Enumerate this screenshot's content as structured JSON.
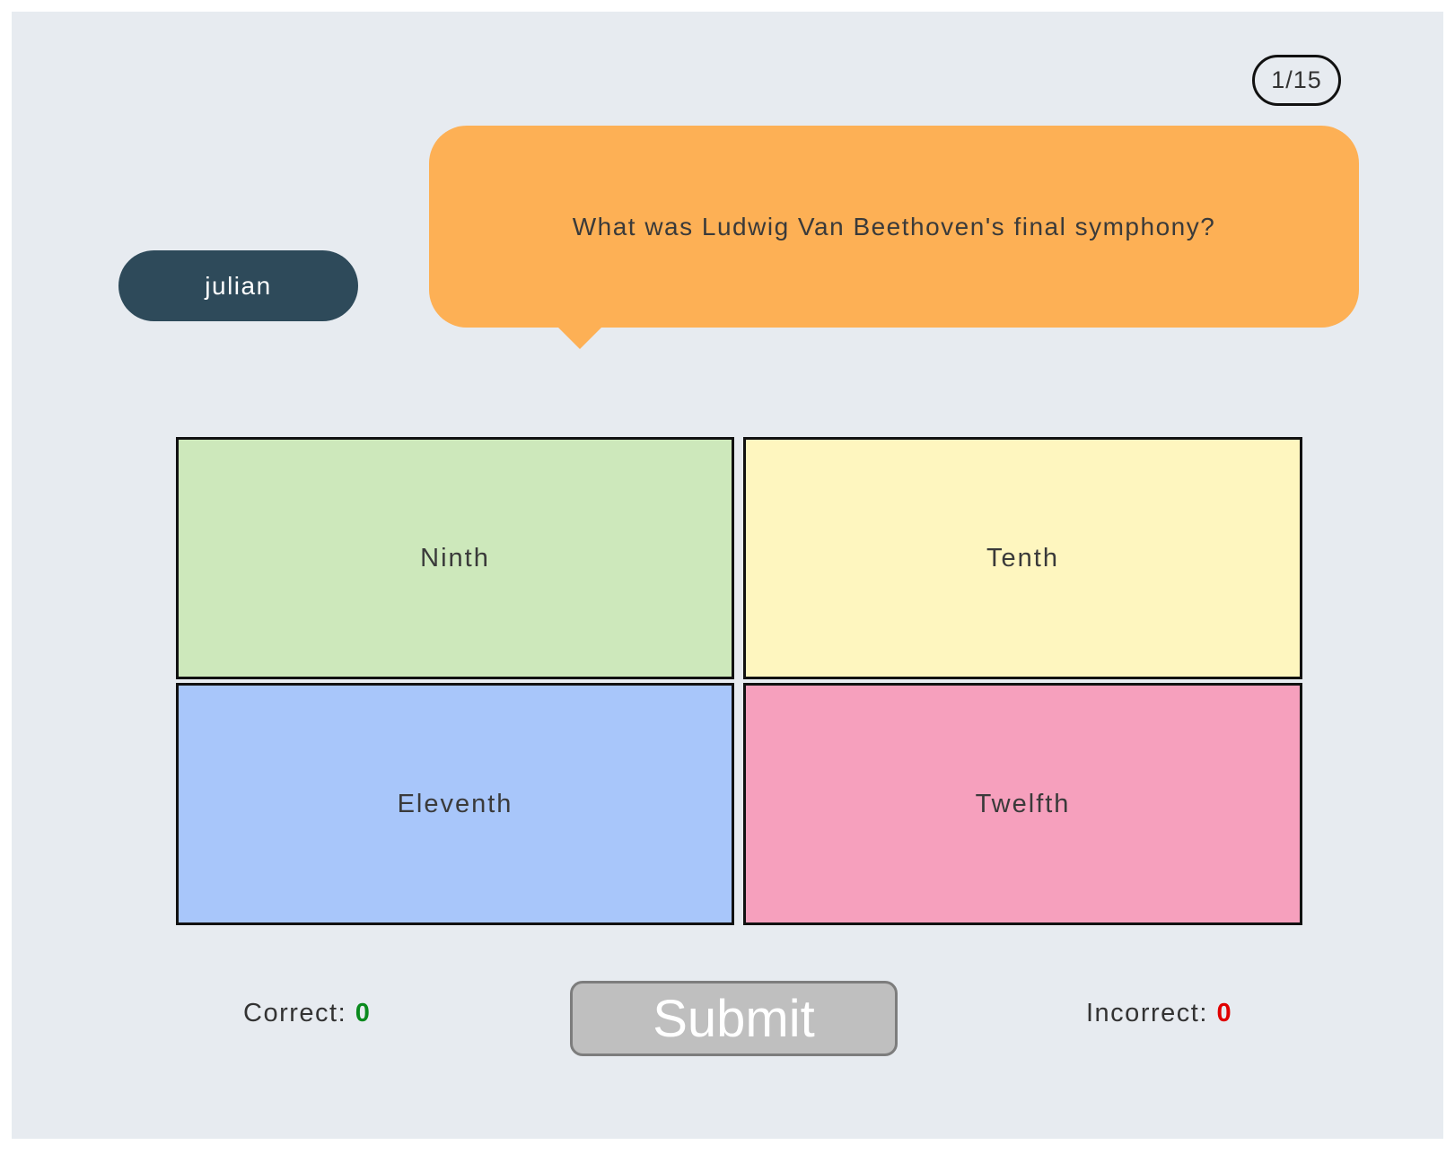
{
  "progress": {
    "counter": "1/15"
  },
  "player": {
    "name": "julian"
  },
  "question": {
    "text": "What was Ludwig Van Beethoven's final symphony?"
  },
  "answers": [
    {
      "label": "Ninth",
      "color": "#cde8bb"
    },
    {
      "label": "Tenth",
      "color": "#fef6bf"
    },
    {
      "label": "Eleventh",
      "color": "#a8c6fa"
    },
    {
      "label": "Twelfth",
      "color": "#f6a0bd"
    }
  ],
  "score": {
    "correct_label": "Correct:",
    "correct_value": "0",
    "incorrect_label": "Incorrect:",
    "incorrect_value": "0"
  },
  "actions": {
    "submit_label": "Submit"
  },
  "colors": {
    "background": "#e7ebf0",
    "bubble": "#fdb055",
    "player_pill": "#2e4a5a",
    "correct": "#0a8a1e",
    "incorrect": "#e00000",
    "submit_disabled": "#bfbfbf"
  }
}
